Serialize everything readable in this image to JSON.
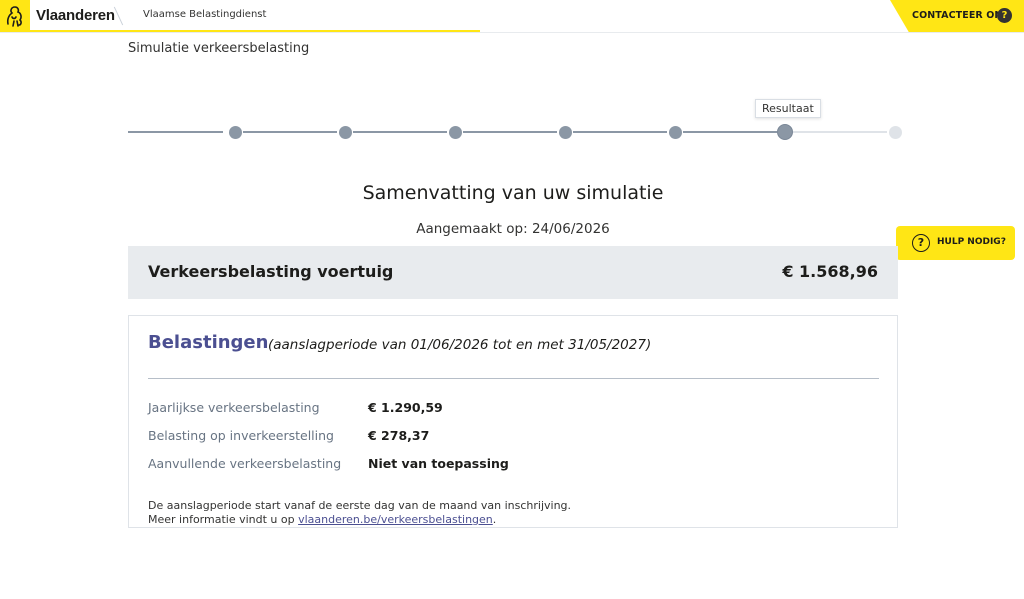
{
  "header": {
    "brand": "Vlaanderen",
    "host": "Vlaamse Belastingdienst",
    "contact_label": "CONTACTEER ONS",
    "contact_icon": "question-icon",
    "logo_icon": "lion-icon"
  },
  "page": {
    "title": "Simulatie verkeersbelasting"
  },
  "stepper": {
    "total_steps": 7,
    "current_step": 6,
    "current_tooltip": "Resultaat"
  },
  "summary": {
    "title": "Samenvatting van uw simulatie",
    "created": "Aangemaakt op: 24/06/2026"
  },
  "help": {
    "label": "HULP NODIG?",
    "icon": "question-icon"
  },
  "total": {
    "label": "Verkeersbelasting voertuig",
    "amount": "€  1.568,96"
  },
  "taxes": {
    "title": "Belastingen",
    "period": "(aanslagperiode van 01/06/2026 tot en met 31/05/2027)",
    "rows": [
      {
        "label": "Jaarlijkse verkeersbelasting",
        "value": "€  1.290,59"
      },
      {
        "label": "Belasting op inverkeerstelling",
        "value": "€  278,37"
      },
      {
        "label": "Aanvullende verkeersbelasting",
        "value": "Niet van toepassing"
      }
    ],
    "note_line1": "De aanslagperiode start vanaf de eerste dag van de maand van inschrijving.",
    "note_line2_prefix": "Meer informatie vindt u op ",
    "note_link": "vlaanderen.be/verkeersbelastingen",
    "note_suffix": "."
  },
  "colors": {
    "brand_yellow": "#ffe615",
    "accent_blue": "#4b4f91",
    "step_done": "#8b97a5",
    "step_future": "#dfe3e8",
    "total_bg": "#e8ebee"
  }
}
